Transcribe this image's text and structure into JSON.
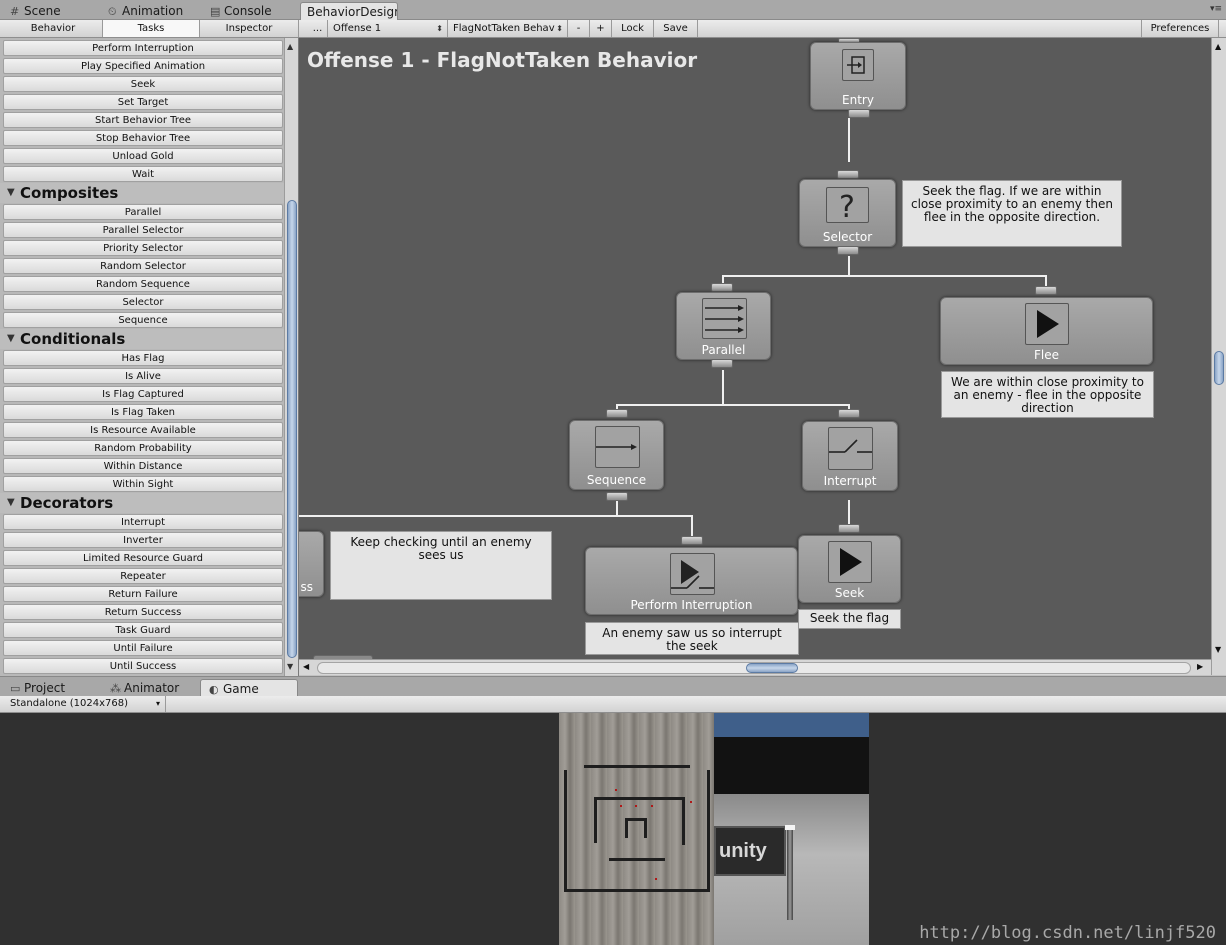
{
  "tabs": [
    {
      "icon": "#",
      "label": "Scene"
    },
    {
      "icon": "⏲",
      "label": "Animation"
    },
    {
      "icon": "▤",
      "label": "Console"
    },
    {
      "icon": "",
      "label": "BehaviorDesigr"
    }
  ],
  "tabs_menu": "▾≡",
  "toolbar": {
    "behavior": "Behavior",
    "tasks": "Tasks",
    "inspector": "Inspector",
    "more": "...",
    "tree_select": "Offense 1",
    "behavior_select": "FlagNotTaken Behav",
    "minus": "-",
    "plus": "+",
    "lock": "Lock",
    "save": "Save",
    "preferences": "Preferences"
  },
  "tasks": {
    "actions_tail": [
      "Perform Interruption",
      "Play Specified Animation",
      "Seek",
      "Set Target",
      "Start Behavior Tree",
      "Stop Behavior Tree",
      "Unload Gold",
      "Wait"
    ],
    "composites_title": "Composites",
    "composites": [
      "Parallel",
      "Parallel Selector",
      "Priority Selector",
      "Random Selector",
      "Random Sequence",
      "Selector",
      "Sequence"
    ],
    "conditionals_title": "Conditionals",
    "conditionals": [
      "Has Flag",
      "Is Alive",
      "Is Flag Captured",
      "Is Flag Taken",
      "Is Resource Available",
      "Random Probability",
      "Within Distance",
      "Within Sight"
    ],
    "decorators_title": "Decorators",
    "decorators": [
      "Interrupt",
      "Inverter",
      "Limited Resource Guard",
      "Repeater",
      "Return Failure",
      "Return Success",
      "Task Guard",
      "Until Failure",
      "Until Success"
    ]
  },
  "graph": {
    "title": "Offense 1 - FlagNotTaken Behavior",
    "nodes": {
      "entry": "Entry",
      "selector": "Selector",
      "parallel": "Parallel",
      "flee": "Flee",
      "sequence": "Sequence",
      "interrupt": "Interrupt",
      "perform_interruption": "Perform Interruption",
      "seek": "Seek",
      "partial": "ss"
    },
    "comments": {
      "selector": "Seek the flag. If we are within close proximity to an enemy then flee in the opposite direction.",
      "flee": "We are within close proximity to an enemy - flee in the opposite direction",
      "partial": "Keep checking until an enemy sees us",
      "perform_interruption": "An enemy saw us so interrupt the seek",
      "seek": "Seek the flag"
    }
  },
  "bottom_tabs": [
    {
      "icon": "▭",
      "label": "Project"
    },
    {
      "icon": "⁂",
      "label": "Animator"
    },
    {
      "icon": "◐",
      "label": "Game"
    }
  ],
  "game": {
    "resolution": "Standalone (1024x768)",
    "sign_text": "unity"
  },
  "watermark": "http://blog.csdn.net/linjf520"
}
